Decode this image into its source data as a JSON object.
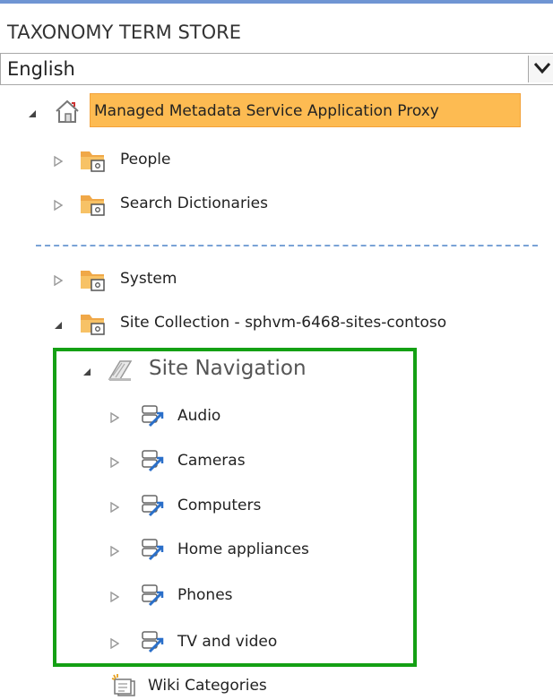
{
  "panel": {
    "title": "TAXONOMY TERM STORE",
    "language": {
      "selected": "English"
    }
  },
  "tree": {
    "root": {
      "label": "Managed Metadata Service Application Proxy",
      "icon": "term-store-house-icon",
      "expanded": true,
      "selected": true
    },
    "groups": [
      {
        "label": "People",
        "icon": "folder-group-icon",
        "expanded": false
      },
      {
        "label": "Search Dictionaries",
        "icon": "folder-group-icon",
        "expanded": false
      },
      {
        "label": "System",
        "icon": "folder-group-icon",
        "expanded": false
      },
      {
        "label": "Site Collection - sphvm-6468-sites-contoso",
        "icon": "folder-group-icon",
        "expanded": true
      }
    ],
    "term_set": {
      "label": "Site Navigation",
      "icon": "navigation-term-set-icon",
      "expanded": true
    },
    "terms": [
      {
        "label": "Audio",
        "icon": "navigation-term-icon"
      },
      {
        "label": "Cameras",
        "icon": "navigation-term-icon"
      },
      {
        "label": "Computers",
        "icon": "navigation-term-icon"
      },
      {
        "label": "Home appliances",
        "icon": "navigation-term-icon"
      },
      {
        "label": "Phones",
        "icon": "navigation-term-icon"
      },
      {
        "label": "TV and video",
        "icon": "navigation-term-icon"
      }
    ],
    "extra_term_set": {
      "label": "Wiki Categories",
      "icon": "wiki-term-set-icon"
    }
  },
  "colors": {
    "selected_bg": "#fdbb52",
    "callout_border": "#14a014",
    "separator": "#7aa3d6",
    "folder": "#f0a848"
  }
}
